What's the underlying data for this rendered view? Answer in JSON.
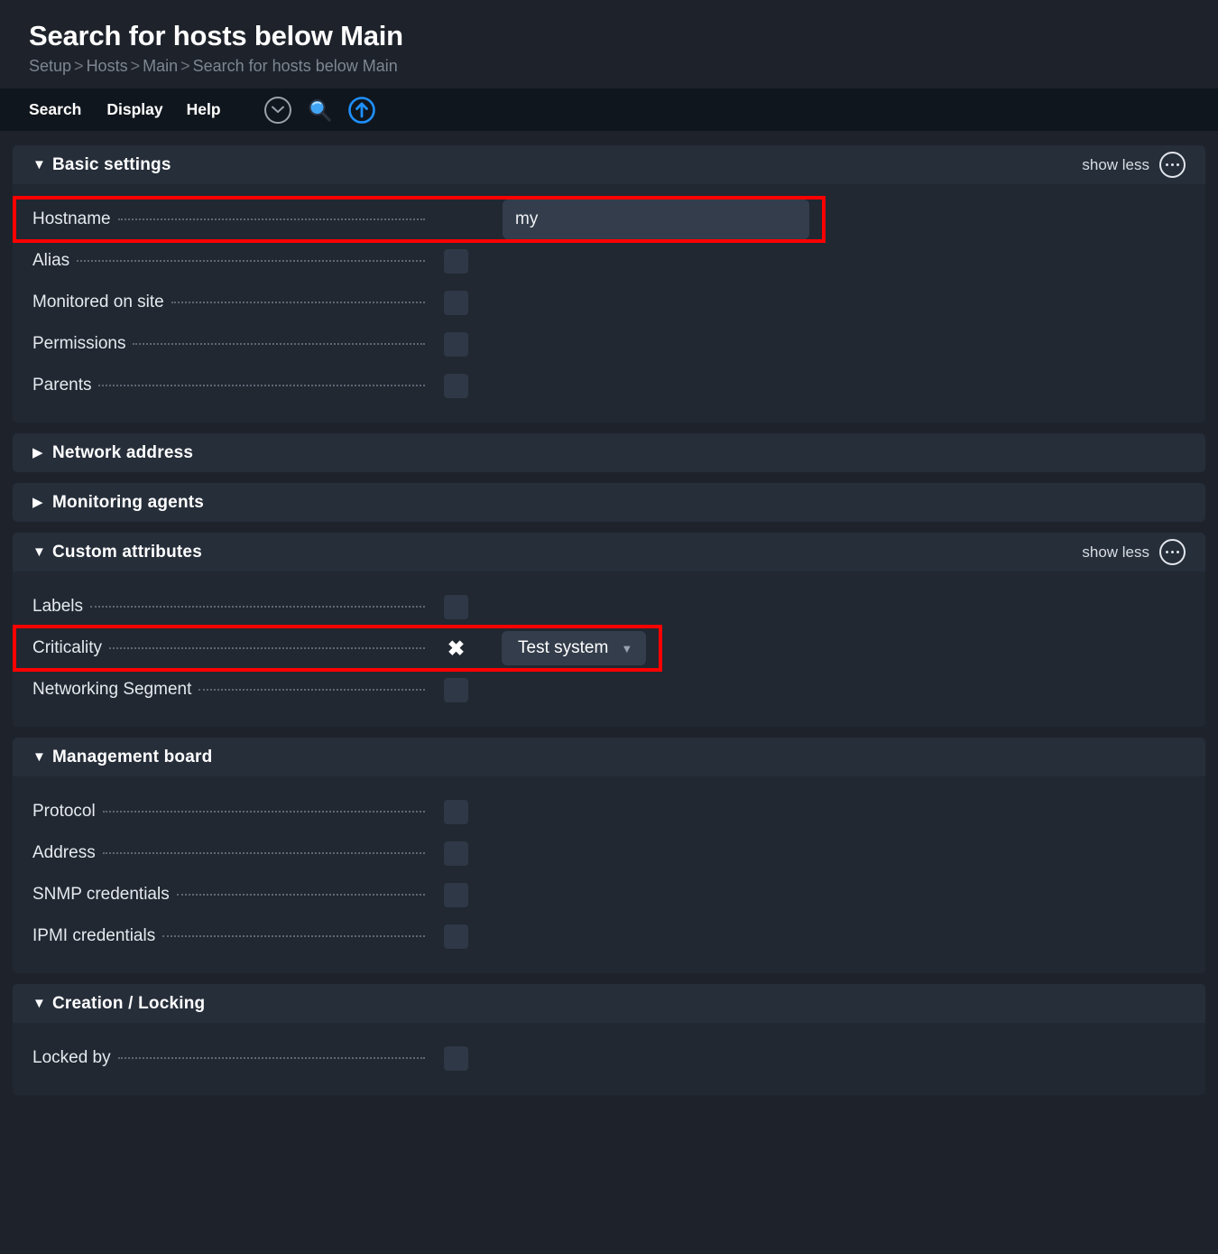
{
  "header": {
    "title": "Search for hosts below Main",
    "breadcrumb": [
      "Setup",
      "Hosts",
      "Main",
      "Search for hosts below Main"
    ],
    "breadcrumb_separator": ">"
  },
  "menubar": {
    "items": [
      {
        "label": "Search"
      },
      {
        "label": "Display"
      },
      {
        "label": "Help"
      }
    ],
    "icons": [
      {
        "name": "chevron-down-circle-icon"
      },
      {
        "name": "search-icon"
      },
      {
        "name": "upload-circle-icon"
      }
    ]
  },
  "colors": {
    "page_background": "#1e232b",
    "menubar_background": "#10161d",
    "section_header": "#262e3a",
    "section_body": "#212832",
    "control_fill": "#333d4b",
    "checkbox_fill": "#2f3846",
    "annotation": "#ff0000",
    "accent_blue": "#1e90ff"
  },
  "show_less_label": "show less",
  "arrows": {
    "expanded": "▼",
    "collapsed": "▶"
  },
  "check_glyph": "✖",
  "caret_glyph": "▼",
  "sections": [
    {
      "title": "Basic settings",
      "expanded": true,
      "show_less": "show less",
      "rows": [
        {
          "label": "Hostname",
          "control": "text",
          "value": "my",
          "highlighted": true
        },
        {
          "label": "Alias",
          "control": "checkbox",
          "checked": false
        },
        {
          "label": "Monitored on site",
          "control": "checkbox",
          "checked": false
        },
        {
          "label": "Permissions",
          "control": "checkbox",
          "checked": false
        },
        {
          "label": "Parents",
          "control": "checkbox",
          "checked": false
        }
      ]
    },
    {
      "title": "Network address",
      "expanded": false,
      "rows": []
    },
    {
      "title": "Monitoring agents",
      "expanded": false,
      "rows": []
    },
    {
      "title": "Custom attributes",
      "expanded": true,
      "show_less": "show less",
      "rows": [
        {
          "label": "Labels",
          "control": "checkbox",
          "checked": false
        },
        {
          "label": "Criticality",
          "control": "select",
          "checked": true,
          "value": "Test system",
          "highlighted": true
        },
        {
          "label": "Networking Segment",
          "control": "checkbox",
          "checked": false
        }
      ]
    },
    {
      "title": "Management board",
      "expanded": true,
      "rows": [
        {
          "label": "Protocol",
          "control": "checkbox",
          "checked": false
        },
        {
          "label": "Address",
          "control": "checkbox",
          "checked": false
        },
        {
          "label": "SNMP credentials",
          "control": "checkbox",
          "checked": false
        },
        {
          "label": "IPMI credentials",
          "control": "checkbox",
          "checked": false
        }
      ]
    },
    {
      "title": "Creation / Locking",
      "expanded": true,
      "rows": [
        {
          "label": "Locked by",
          "control": "checkbox",
          "checked": false
        }
      ]
    }
  ]
}
